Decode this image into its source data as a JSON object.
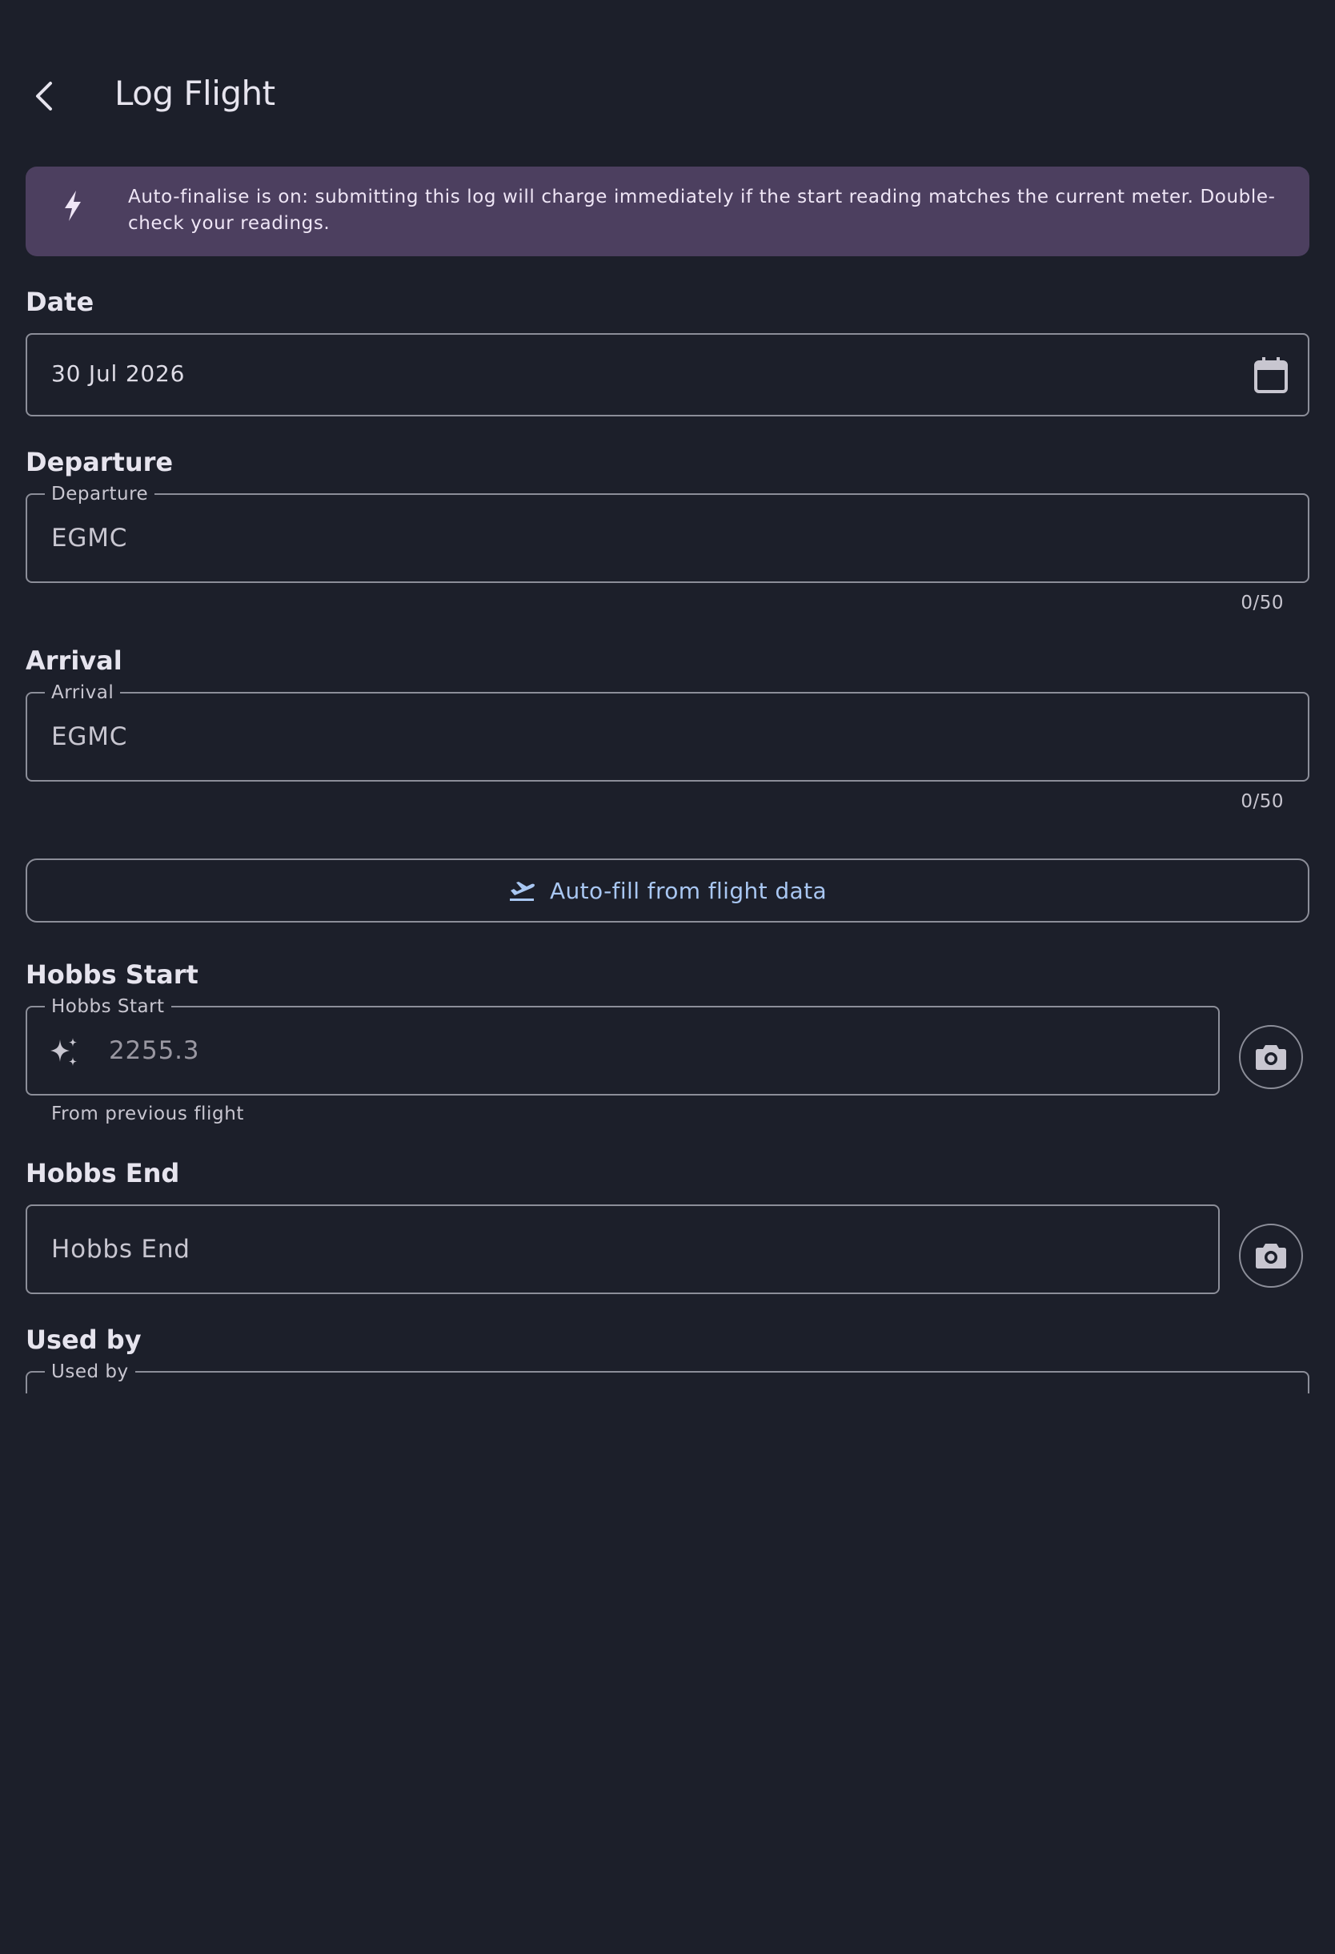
{
  "header": {
    "title": "Log Flight"
  },
  "banner": {
    "text": "Auto-finalise is on: submitting this log will charge immediately if the start reading matches the current meter. Double-check your readings."
  },
  "date": {
    "section_label": "Date",
    "value": "30 Jul 2026"
  },
  "departure": {
    "section_label": "Departure",
    "field_label": "Departure",
    "value": "EGMC",
    "counter": "0/50"
  },
  "arrival": {
    "section_label": "Arrival",
    "field_label": "Arrival",
    "value": "EGMC",
    "counter": "0/50"
  },
  "autofill": {
    "label": "Auto-fill from flight data"
  },
  "hobbs_start": {
    "section_label": "Hobbs Start",
    "field_label": "Hobbs Start",
    "value": "2255.3",
    "helper": "From previous flight"
  },
  "hobbs_end": {
    "section_label": "Hobbs End",
    "placeholder": "Hobbs End"
  },
  "used_by": {
    "section_label": "Used by",
    "field_label": "Used by"
  },
  "colors": {
    "background": "#1c1f2a",
    "banner": "#4c3f5f",
    "accent": "#a9c7f2",
    "outline": "#8c8e99"
  }
}
